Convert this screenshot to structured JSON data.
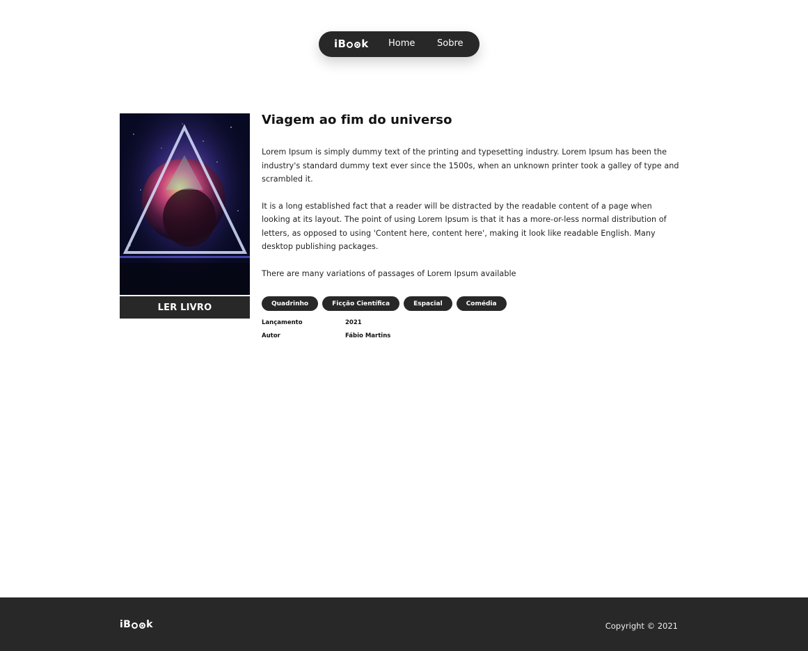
{
  "nav": {
    "brand": {
      "pre": "iB",
      "post": "k"
    },
    "links": [
      "Home",
      "Sobre"
    ]
  },
  "book": {
    "title": "Viagem ao fim do universo",
    "read_button": "LER LIVRO",
    "paragraphs": [
      "Lorem Ipsum is simply dummy text of the printing and typesetting industry. Lorem Ipsum has been the industry's standard dummy text ever since the 1500s, when an unknown printer took a galley of type and scrambled it.",
      "It is a long established fact that a reader will be distracted by the readable content of a page when looking at its layout. The point of using Lorem Ipsum is that it has a more-or-less normal distribution of letters, as opposed to using 'Content here, content here', making it look like readable English. Many desktop publishing packages.",
      "There are many variations of passages of Lorem Ipsum available"
    ],
    "tags": [
      "Quadrinho",
      "Ficção Científica",
      "Espacial",
      "Comédia"
    ],
    "meta": [
      {
        "label": "Lançamento",
        "value": "2021"
      },
      {
        "label": "Autor",
        "value": "Fábio Martins"
      }
    ]
  },
  "footer": {
    "brand": {
      "pre": "iB",
      "post": "k"
    },
    "copyright": "Copyright © 2021"
  },
  "colors": {
    "dark": "#282828",
    "background": "#ffffff"
  },
  "icons": {
    "cover": "astronaut-helmet-cover-art"
  }
}
